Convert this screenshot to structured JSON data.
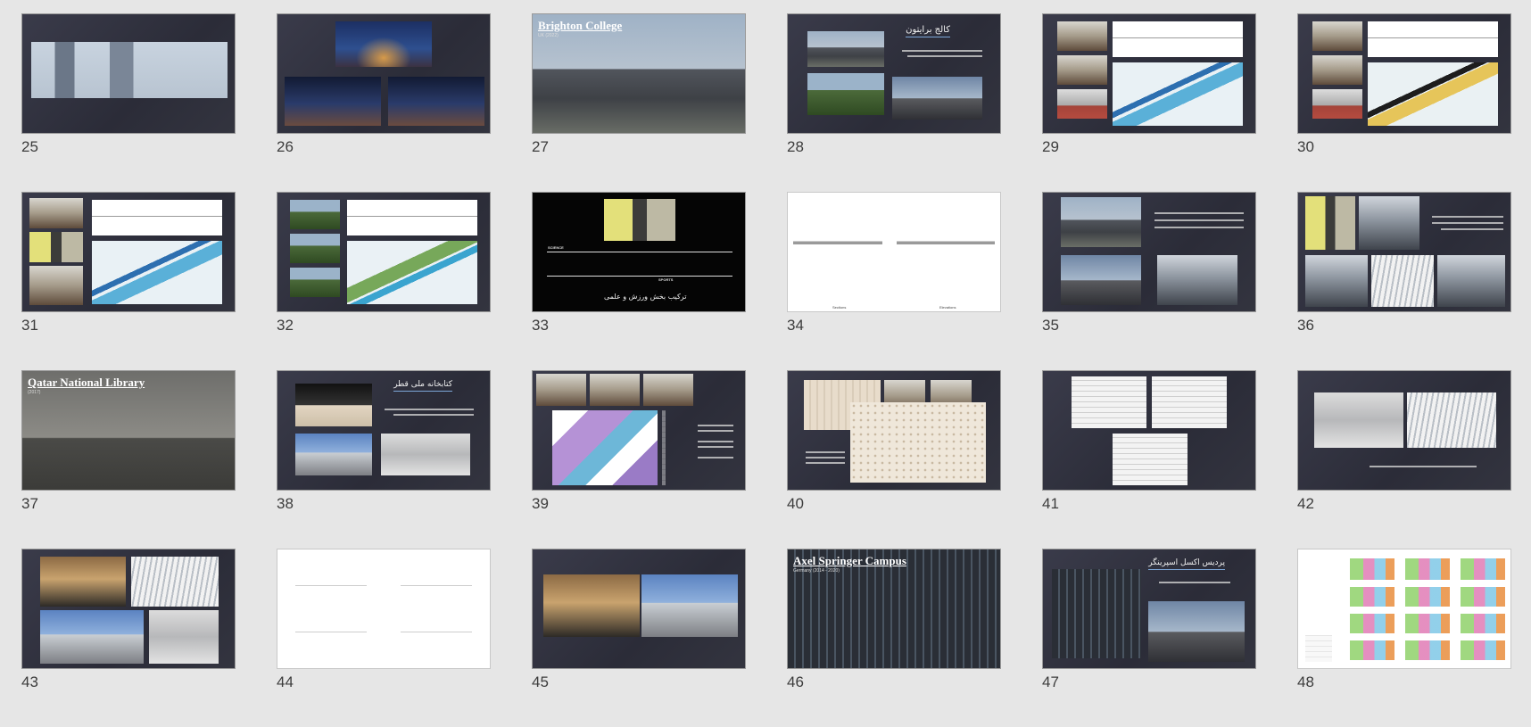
{
  "slides": [
    {
      "num": "25"
    },
    {
      "num": "26"
    },
    {
      "num": "27"
    },
    {
      "num": "28"
    },
    {
      "num": "29"
    },
    {
      "num": "30"
    },
    {
      "num": "31"
    },
    {
      "num": "32"
    },
    {
      "num": "33"
    },
    {
      "num": "34"
    },
    {
      "num": "35"
    },
    {
      "num": "36"
    },
    {
      "num": "37"
    },
    {
      "num": "38"
    },
    {
      "num": "39"
    },
    {
      "num": "40"
    },
    {
      "num": "41"
    },
    {
      "num": "42"
    },
    {
      "num": "43"
    },
    {
      "num": "44"
    },
    {
      "num": "45"
    },
    {
      "num": "46"
    },
    {
      "num": "47"
    },
    {
      "num": "48"
    }
  ],
  "text": {
    "brighton_title": "Brighton College",
    "brighton_sub": "UK (2022)",
    "brighton_fa": "کالج برایتون",
    "s33_science": "SCIENCE",
    "s33_sports": "SPORTS",
    "s33_fa": "ترکیب بخش ورزش و علمی",
    "qatar_title": "Qatar National Library",
    "qatar_sub": "(2017)",
    "qatar_fa": "کتابخانه ملی قطر",
    "axel_title": "Axel Springer Campus",
    "axel_sub": "Germany (2014 - 2020)",
    "axel_fa": "پردیس اکسل اسپرینگر",
    "s34_left": "Sections",
    "s34_right": "Elevations"
  },
  "colors": {
    "page_bg": "#e6e6e6",
    "slide_bg": "#2f303c",
    "accent_underline": "#7da7d9"
  }
}
